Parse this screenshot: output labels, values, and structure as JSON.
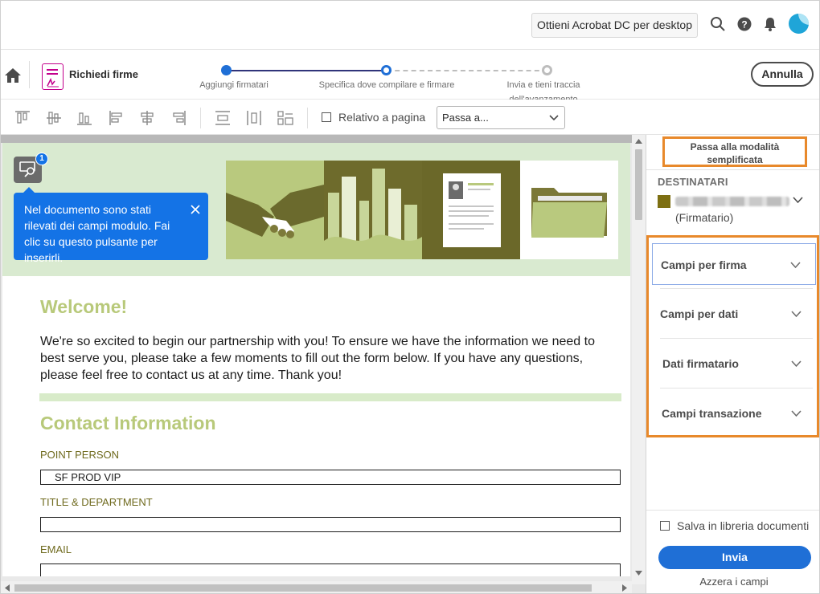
{
  "topbar": {
    "desktop_cta": "Ottieni Acrobat DC per desktop",
    "icons": [
      "search-icon",
      "help-icon",
      "bell-icon",
      "avatar"
    ]
  },
  "workflow": {
    "tool_name": "Richiedi firme",
    "steps": [
      {
        "label": "Aggiungi firmatari",
        "state": "done"
      },
      {
        "label": "Specifica dove compilare e firmare",
        "state": "current"
      },
      {
        "label_line1": "Invia e tieni traccia",
        "label_line2": "dell'avanzamento",
        "state": "pending"
      }
    ],
    "cancel_label": "Annulla"
  },
  "toolbar": {
    "relative_label": "Relativo a pagina",
    "relative_checked": false,
    "goto_value": "Passa a..."
  },
  "document": {
    "tooltip": {
      "badge": "1",
      "text": "Nel documento sono stati rilevati dei campi modulo. Fai clic su questo pulsante per inserirli."
    },
    "welcome_title": "Welcome!",
    "intro": "We're so excited to begin our partnership with you! To ensure we have the information we need to best serve you, please take a few moments to fill out the form below. If you have any questions, please feel free to contact us at any time. Thank you!",
    "contact_title": "Contact Information",
    "fields": [
      {
        "label": "POINT PERSON",
        "value": "SF PROD VIP"
      },
      {
        "label": "TITLE & DEPARTMENT",
        "value": ""
      },
      {
        "label": "EMAIL",
        "value": ""
      }
    ]
  },
  "panel": {
    "simplified_mode": "Passa alla modalità semplificata",
    "recipients_title": "DESTINATARI",
    "recipient_role": "(Firmatario)",
    "recipient_color": "#7d6f12",
    "accordion": [
      "Campi per firma",
      "Campi per dati",
      "Dati firmatario",
      "Campi transazione"
    ],
    "save_label": "Salva in libreria documenti",
    "send_label": "Invia",
    "reset_label": "Azzera i campi"
  },
  "colors": {
    "accent_blue": "#1473e6",
    "highlight_orange": "#e8892b",
    "heading_green": "#b8c97a",
    "banner_green": "#d9ead0",
    "olive": "#7d6f12"
  }
}
